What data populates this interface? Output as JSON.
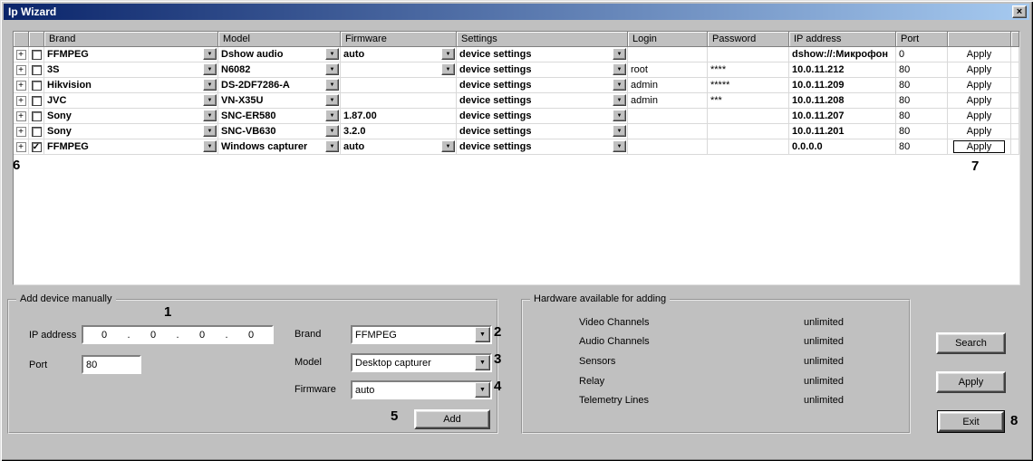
{
  "window": {
    "title": "Ip Wizard"
  },
  "icons": {
    "close": "×",
    "dropdown": "▼",
    "expand": "+"
  },
  "table": {
    "headers": {
      "brand": "Brand",
      "model": "Model",
      "firmware": "Firmware",
      "settings": "Settings",
      "login": "Login",
      "password": "Password",
      "ip": "IP address",
      "port": "Port"
    },
    "rows": [
      {
        "check": "",
        "brand": "FFMPEG",
        "model": "Dshow audio",
        "firmware": "auto",
        "settings": "device settings",
        "login": "",
        "password": "",
        "ip": "dshow://:Микрофон",
        "port": "0",
        "apply": "Apply"
      },
      {
        "check": "",
        "brand": "3S",
        "model": "N6082",
        "firmware": "",
        "settings": "device settings",
        "login": "root",
        "password": "****",
        "ip": "10.0.11.212",
        "port": "80",
        "apply": "Apply"
      },
      {
        "check": "",
        "brand": "Hikvision",
        "model": "DS-2DF7286-A",
        "firmware": "",
        "settings": "device settings",
        "login": "admin",
        "password": "*****",
        "ip": "10.0.11.209",
        "port": "80",
        "apply": "Apply"
      },
      {
        "check": "",
        "brand": "JVC",
        "model": "VN-X35U",
        "firmware": "",
        "settings": "device settings",
        "login": "admin",
        "password": "***",
        "ip": "10.0.11.208",
        "port": "80",
        "apply": "Apply"
      },
      {
        "check": "",
        "brand": "Sony",
        "model": "SNC-ER580",
        "firmware": "1.87.00",
        "settings": "device settings",
        "login": "",
        "password": "",
        "ip": "10.0.11.207",
        "port": "80",
        "apply": "Apply"
      },
      {
        "check": "",
        "brand": "Sony",
        "model": "SNC-VB630",
        "firmware": "3.2.0",
        "settings": "device settings",
        "login": "",
        "password": "",
        "ip": "10.0.11.201",
        "port": "80",
        "apply": "Apply"
      },
      {
        "check": "✓",
        "brand": "FFMPEG",
        "model": "Windows capturer",
        "firmware": "auto",
        "settings": "device settings",
        "login": "",
        "password": "",
        "ip": "0.0.0.0",
        "port": "80",
        "apply": "Apply"
      }
    ]
  },
  "add_device": {
    "group_title": "Add device manually",
    "ip_label": "IP address",
    "ip_octets": [
      "0",
      "0",
      "0",
      "0"
    ],
    "ip_separator": ".",
    "port_label": "Port",
    "port_value": "80",
    "brand_label": "Brand",
    "brand_value": "FFMPEG",
    "model_label": "Model",
    "model_value": "Desktop capturer",
    "firmware_label": "Firmware",
    "firmware_value": "auto",
    "add_button": "Add"
  },
  "hardware": {
    "group_title": "Hardware available for adding",
    "items": [
      {
        "label": "Video Channels",
        "value": "unlimited"
      },
      {
        "label": "Audio Channels",
        "value": "unlimited"
      },
      {
        "label": "Sensors",
        "value": "unlimited"
      },
      {
        "label": "Relay",
        "value": "unlimited"
      },
      {
        "label": "Telemetry Lines",
        "value": "unlimited"
      }
    ]
  },
  "side_buttons": {
    "search": "Search",
    "apply": "Apply",
    "exit": "Exit"
  },
  "annotations": [
    "1",
    "2",
    "3",
    "4",
    "5",
    "6",
    "7",
    "8"
  ]
}
